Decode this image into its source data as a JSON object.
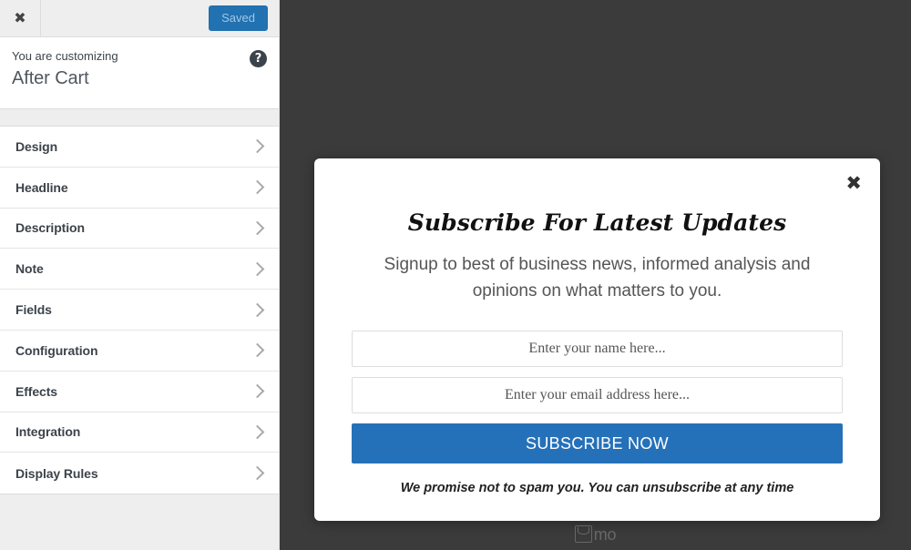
{
  "customizer": {
    "topbar": {
      "close_icon": "close-icon",
      "save_button_label": "Saved"
    },
    "header": {
      "eyebrow": "You are customizing",
      "title": "After Cart",
      "help_icon": "help-icon",
      "help_glyph": "?"
    },
    "menu": [
      {
        "label": "Design"
      },
      {
        "label": "Headline"
      },
      {
        "label": "Description"
      },
      {
        "label": "Note"
      },
      {
        "label": "Fields"
      },
      {
        "label": "Configuration"
      },
      {
        "label": "Effects"
      },
      {
        "label": "Integration"
      },
      {
        "label": "Display Rules"
      }
    ]
  },
  "preview": {
    "background_color": "#3b3b3b",
    "modal": {
      "close_icon": "close-icon",
      "close_glyph": "✖",
      "headline": "Subscribe For Latest Updates",
      "description": "Signup to best of business news, informed analysis and opinions on what matters to you.",
      "fields": [
        {
          "name": "name-field",
          "placeholder": "Enter your name here...",
          "value": ""
        },
        {
          "name": "email-field",
          "placeholder": "Enter your email address here...",
          "value": ""
        }
      ],
      "submit_label": "SUBSCRIBE NOW",
      "submit_color": "#2571b9",
      "footnote": "We promise not to spam you. You can unsubscribe at any time"
    },
    "brand": {
      "icon": "envelope-icon",
      "text": "mo"
    }
  }
}
